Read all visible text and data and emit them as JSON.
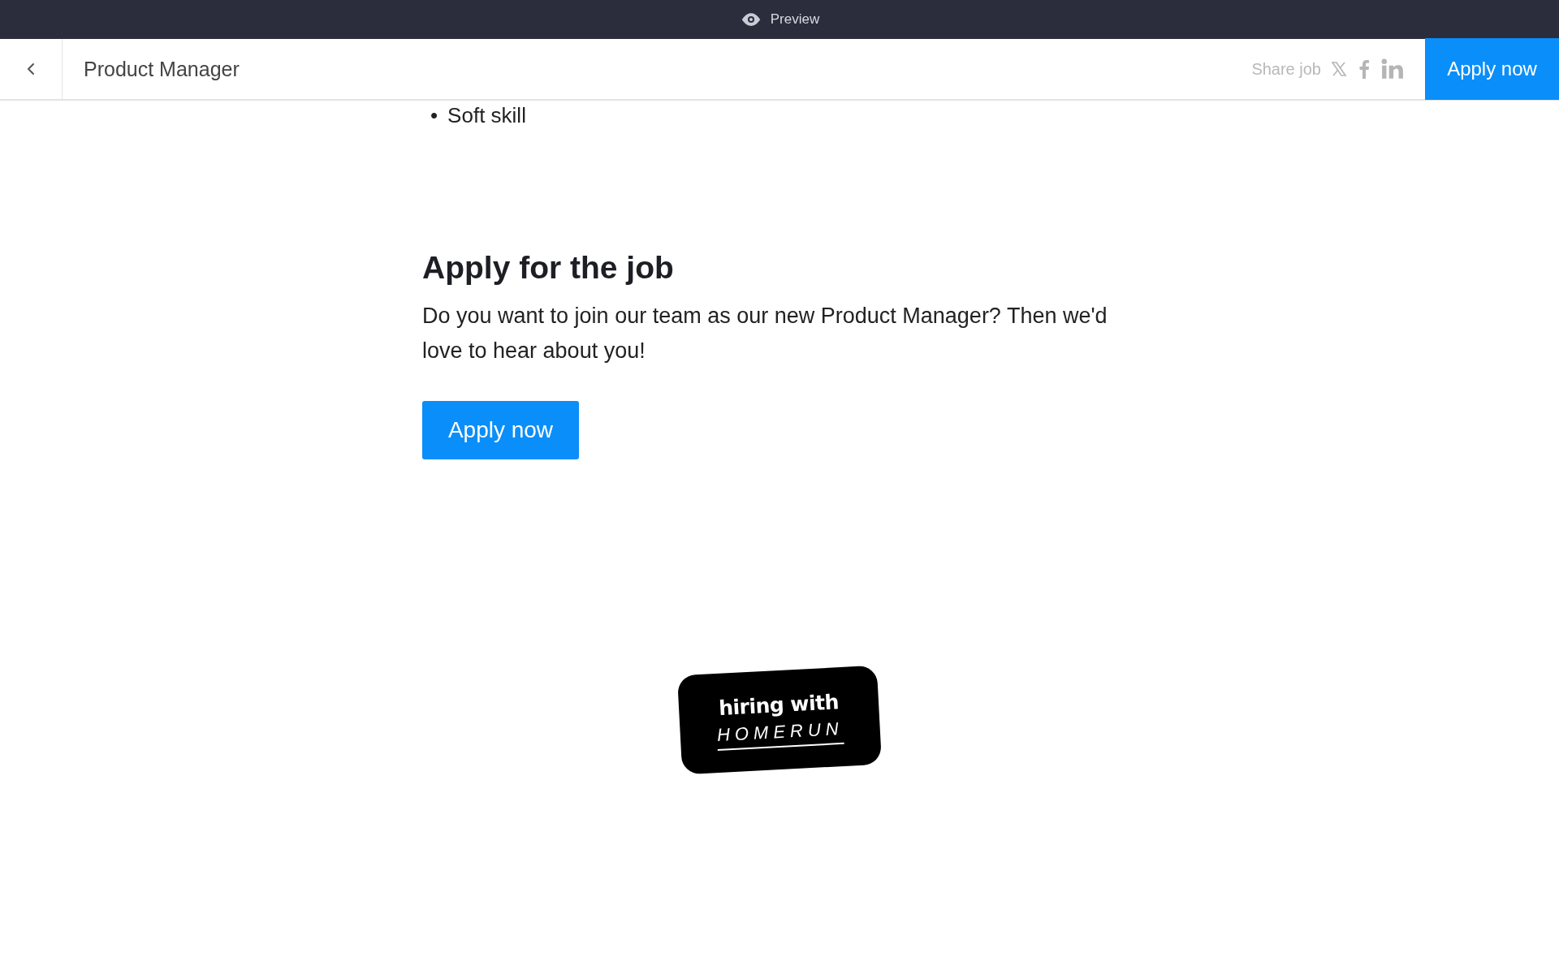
{
  "preview_bar": {
    "label": "Preview"
  },
  "header": {
    "title": "Product Manager",
    "share_label": "Share job",
    "apply_button": "Apply now"
  },
  "content": {
    "list_items": [
      {
        "bullet": "•",
        "text": "Soft skill"
      }
    ],
    "heading": "Apply for the job",
    "text": "Do you want to join our team as our new Product Manager? Then we'd love to hear about you!",
    "apply_button": "Apply now"
  },
  "badge": {
    "line_1": "hiring with",
    "line_2": "HOMERUN"
  }
}
